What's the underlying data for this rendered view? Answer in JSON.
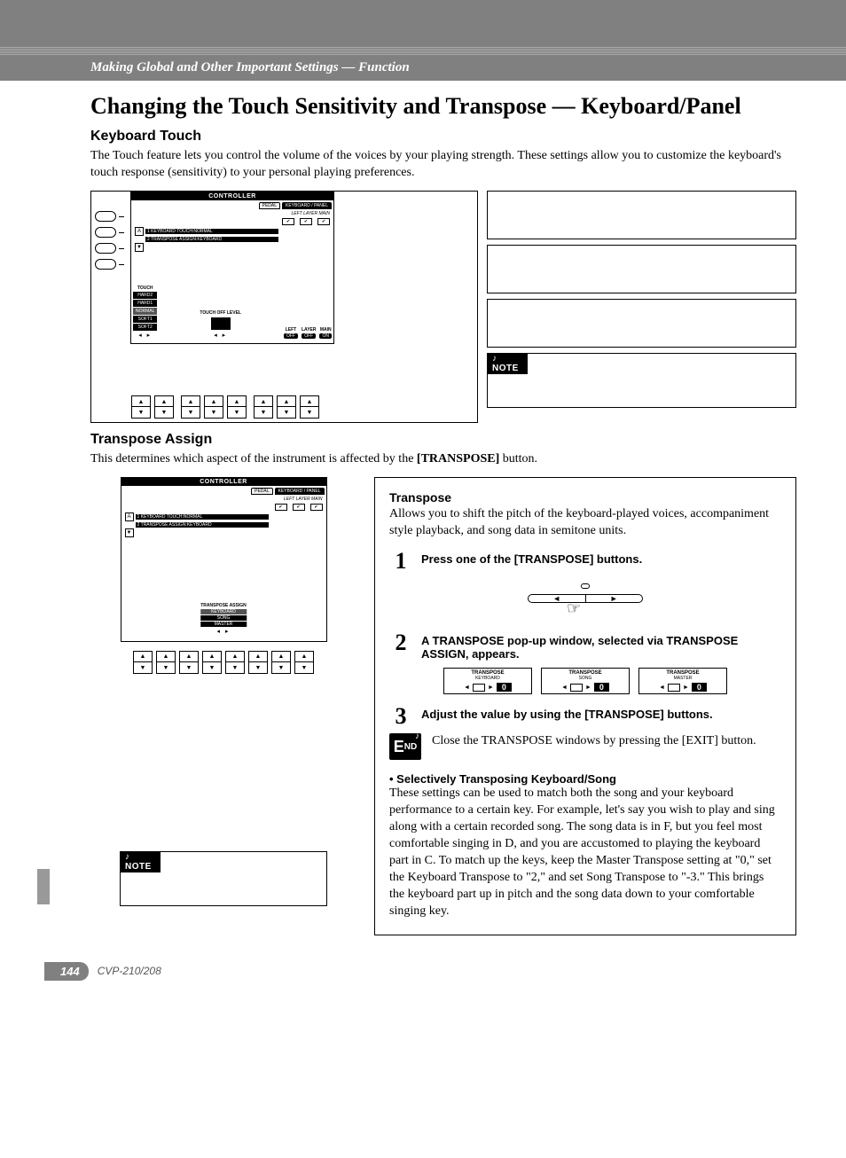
{
  "breadcrumb": "Making Global and Other Important Settings — Function",
  "title": "Changing the Touch Sensitivity and Transpose — Keyboard/Panel",
  "sec1": {
    "heading": "Keyboard Touch",
    "body": "The Touch feature lets you control the volume of the voices by your playing strength. These settings allow you to customize the keyboard's touch response (sensitivity) to your personal playing preferences."
  },
  "screen1": {
    "title": "CONTROLLER",
    "tabs": {
      "left": "PEDAL",
      "right": "KEYBOARD / PANEL"
    },
    "checklabels": "LEFT LAYER MAIN",
    "row1": "1  KEYBOARD TOUCH:NORMAL",
    "row2": "2  TRANSPOSE ASSIGN:KEYBOARD",
    "touch": {
      "label": "TOUCH",
      "opts": [
        "HARD2",
        "HARD1",
        "NORMAL",
        "SOFT1",
        "SOFT2"
      ]
    },
    "level": {
      "label": "TOUCH OFF LEVEL"
    },
    "switches": {
      "cols": [
        "LEFT",
        "LAYER",
        "MAIN"
      ],
      "vals": [
        "OFF",
        "OFF",
        "ON"
      ]
    }
  },
  "sec2": {
    "heading": "Transpose Assign",
    "body_pre": "This determines which aspect of the instrument is affected by the ",
    "body_bold": "[TRANSPOSE]",
    "body_post": " button."
  },
  "screen2": {
    "title": "CONTROLLER",
    "tabs": {
      "left": "PEDAL",
      "right": "KEYBOARD / PANEL"
    },
    "checklabels": "LEFT LAYER MAIN",
    "row1": "1  KEYBOARD TOUCH:NORMAL",
    "row2": "2  TRANSPOSE ASSIGN:KEYBOARD",
    "assign": {
      "label": "TRANSPOSE ASSIGN",
      "opts": [
        "KEYBOARD",
        "SONG",
        "MASTER"
      ]
    }
  },
  "note_label": "♪ NOTE",
  "right": {
    "transpose_h": "Transpose",
    "transpose_b": "Allows you to shift the pitch of the keyboard-played voices, accompaniment style playback, and song data in semitone units.",
    "step1": "Press one of the [TRANSPOSE] buttons.",
    "step2": "A TRANSPOSE pop-up window, selected via TRANSPOSE ASSIGN, appears.",
    "step3": "Adjust the value by using the [TRANSPOSE] buttons.",
    "end_label": "END",
    "end_body": "Close the TRANSPOSE windows by pressing the [EXIT] button.",
    "pops": [
      {
        "t": "TRANSPOSE",
        "s": "KEYBOARD",
        "v": "0"
      },
      {
        "t": "TRANSPOSE",
        "s": "SONG",
        "v": "0"
      },
      {
        "t": "TRANSPOSE",
        "s": "MASTER",
        "v": "0"
      }
    ],
    "bullet_h": "•  Selectively Transposing Keyboard/Song",
    "bullet_b": "These settings can be used to match both the song and your keyboard performance to a certain key. For example, let's say you wish to play and sing along with a certain recorded song. The song data is in F, but you feel most comfortable singing in D, and you are accustomed to playing the keyboard part in C. To match up the keys, keep the Master Transpose setting at \"0,\" set the Keyboard Transpose to \"2,\" and set Song Transpose to \"-3.\" This brings the keyboard part up in pitch and the song data down to your comfortable singing key."
  },
  "footer": {
    "page": "144",
    "model": "CVP-210/208"
  },
  "glyph": {
    "up": "▲",
    "down": "▼",
    "left": "◄",
    "right": "►",
    "check": "✔"
  }
}
